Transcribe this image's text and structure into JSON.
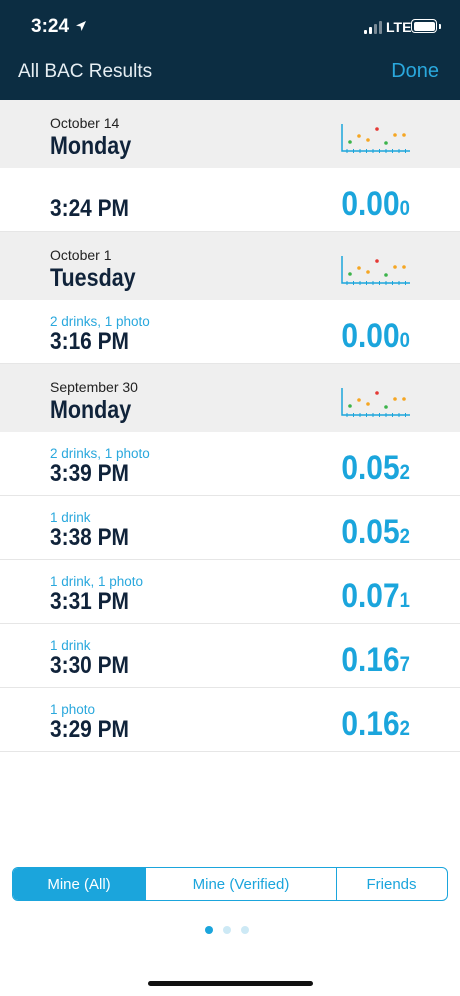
{
  "status_bar": {
    "time": "3:24",
    "network": "LTE"
  },
  "nav": {
    "title": "All BAC Results",
    "done": "Done"
  },
  "sections": [
    {
      "date": "October 14",
      "day": "Monday",
      "entries": [
        {
          "subtitle": "",
          "time": "3:24 PM",
          "bac_main": "0.00",
          "bac_last": "0"
        }
      ]
    },
    {
      "date": "October 1",
      "day": "Tuesday",
      "entries": [
        {
          "subtitle": "2 drinks, 1 photo",
          "time": "3:16 PM",
          "bac_main": "0.00",
          "bac_last": "0"
        }
      ]
    },
    {
      "date": "September 30",
      "day": "Monday",
      "entries": [
        {
          "subtitle": "2 drinks, 1 photo",
          "time": "3:39 PM",
          "bac_main": "0.05",
          "bac_last": "2"
        },
        {
          "subtitle": "1 drink",
          "time": "3:38 PM",
          "bac_main": "0.05",
          "bac_last": "2"
        },
        {
          "subtitle": "1 drink, 1 photo",
          "time": "3:31 PM",
          "bac_main": "0.07",
          "bac_last": "1"
        },
        {
          "subtitle": "1 drink",
          "time": "3:30 PM",
          "bac_main": "0.16",
          "bac_last": "7"
        },
        {
          "subtitle": "1 photo",
          "time": "3:29 PM",
          "bac_main": "0.16",
          "bac_last": "2"
        }
      ]
    }
  ],
  "segments": [
    {
      "label": "Mine (All)",
      "active": true
    },
    {
      "label": "Mine (Verified)",
      "active": false
    },
    {
      "label": "Friends",
      "active": false
    }
  ],
  "page_indicator": {
    "total": 3,
    "current": 1
  },
  "colors": {
    "accent": "#1ba5dc",
    "nav_bg": "#0c2d42",
    "section_bg": "#efefef",
    "text_dark": "#10233a"
  }
}
